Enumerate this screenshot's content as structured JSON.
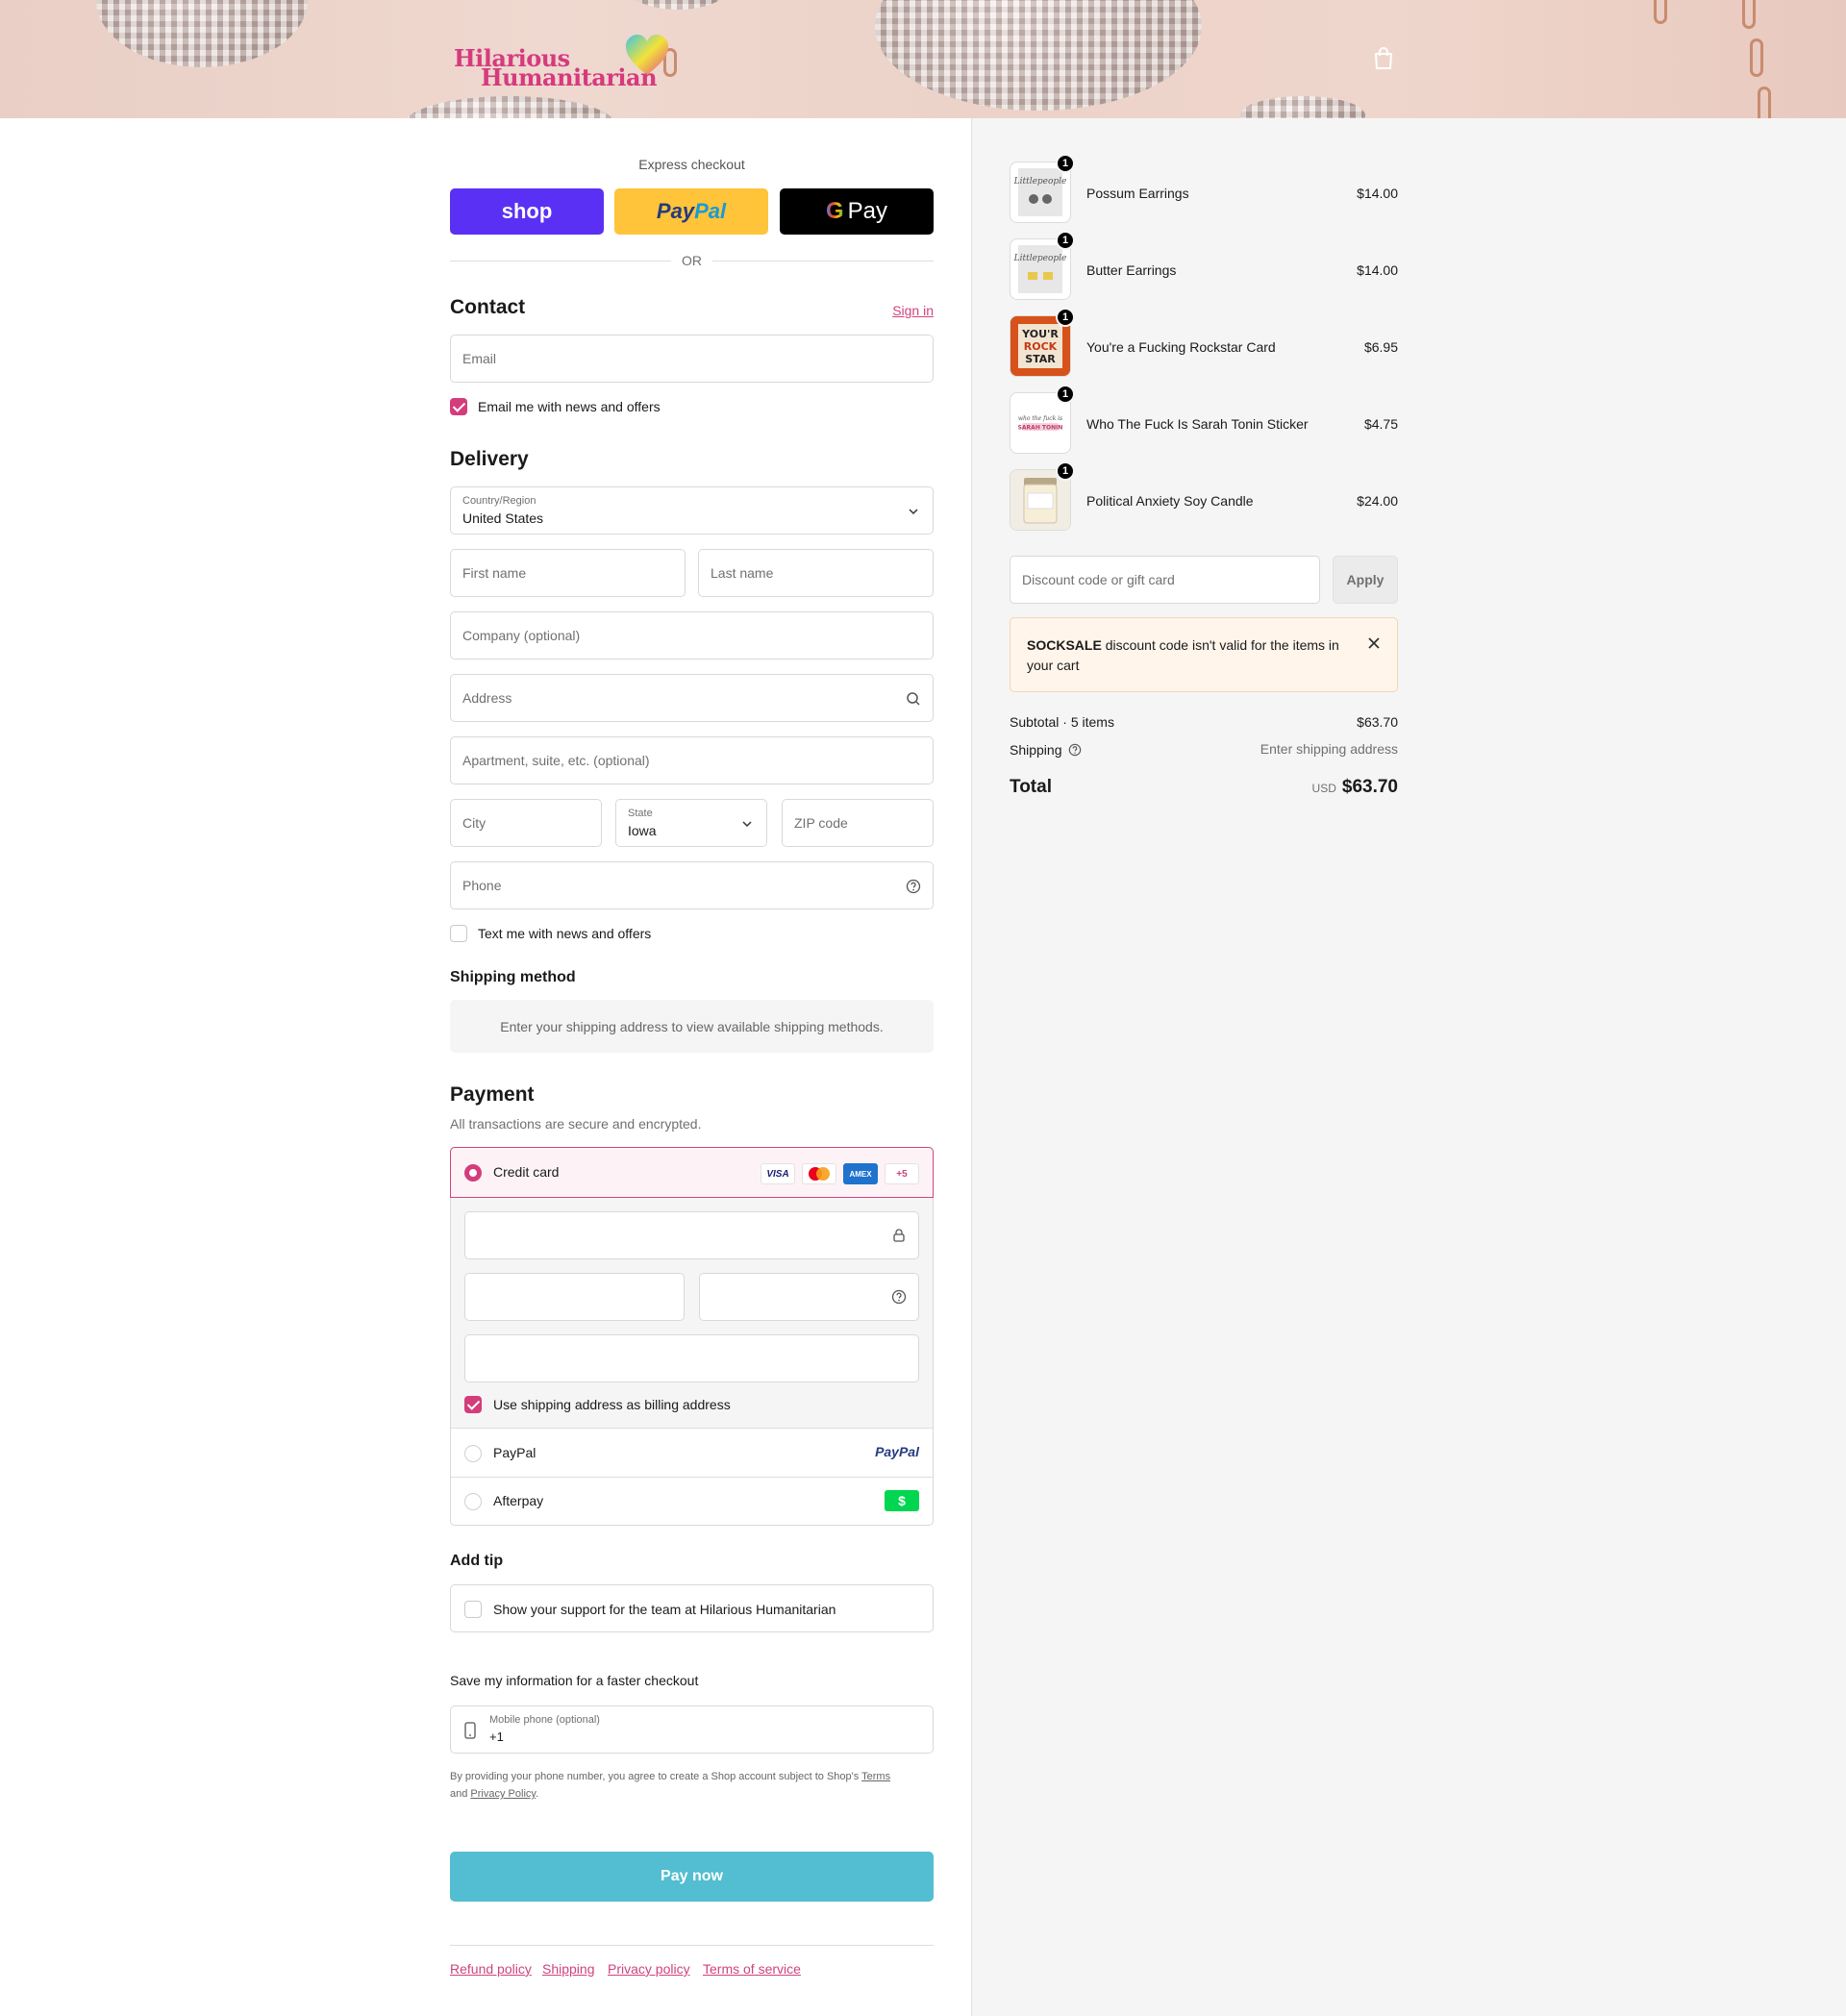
{
  "header": {
    "logo_line1": "Hilarious",
    "logo_line2": "Humanitarian"
  },
  "express": {
    "title": "Express checkout",
    "shop_label": "shop",
    "paypal_label": "PayPal",
    "gpay_label": "G Pay",
    "or_label": "OR"
  },
  "contact": {
    "heading": "Contact",
    "sign_in": "Sign in",
    "email_placeholder": "Email",
    "news_label": "Email me with news and offers",
    "news_checked": true
  },
  "delivery": {
    "heading": "Delivery",
    "country_label": "Country/Region",
    "country_value": "United States",
    "first_name": "First name",
    "last_name": "Last name",
    "company": "Company (optional)",
    "address": "Address",
    "apartment": "Apartment, suite, etc. (optional)",
    "city": "City",
    "state_label": "State",
    "state_value": "Iowa",
    "zip": "ZIP code",
    "phone": "Phone",
    "text_news_label": "Text me with news and offers"
  },
  "shipping_method": {
    "heading": "Shipping method",
    "message": "Enter your shipping address to view available shipping methods."
  },
  "payment": {
    "heading": "Payment",
    "subtitle": "All transactions are secure and encrypted.",
    "credit_card_label": "Credit card",
    "brands": [
      "VISA",
      "MC",
      "AMEX",
      "+5"
    ],
    "billing_label": "Use shipping address as billing address",
    "paypal_label": "PayPal",
    "paypal_logo": "PayPal",
    "afterpay_label": "Afterpay",
    "afterpay_logo": "$"
  },
  "tip": {
    "heading": "Add tip",
    "label": "Show your support for the team at Hilarious Humanitarian"
  },
  "save_info": {
    "heading": "Save my information for a faster checkout",
    "mobile_label": "Mobile phone (optional)",
    "mobile_value": "+1",
    "disclaimer_pre": "By providing your phone number, you agree to create a Shop account subject to Shop's",
    "terms": "Terms",
    "and": "and",
    "privacy": "Privacy Policy",
    "period": "."
  },
  "pay_now": "Pay now",
  "footer": {
    "links": [
      "Refund policy",
      "Shipping",
      "Privacy policy",
      "Terms of service"
    ]
  },
  "cart": {
    "items": [
      {
        "name": "Possum Earrings",
        "price": "$14.00",
        "qty": "1"
      },
      {
        "name": "Butter Earrings",
        "price": "$14.00",
        "qty": "1"
      },
      {
        "name": "You're a Fucking Rockstar Card",
        "price": "$6.95",
        "qty": "1"
      },
      {
        "name": "Who The Fuck Is Sarah Tonin Sticker",
        "price": "$4.75",
        "qty": "1"
      },
      {
        "name": "Political Anxiety Soy Candle",
        "price": "$24.00",
        "qty": "1"
      }
    ],
    "discount_placeholder": "Discount code or gift card",
    "apply_label": "Apply",
    "alert_code": "SOCKSALE",
    "alert_text": "discount code isn't valid for the items in your cart",
    "subtotal_label": "Subtotal · 5 items",
    "subtotal_value": "$63.70",
    "shipping_label": "Shipping",
    "shipping_value": "Enter shipping address",
    "total_label": "Total",
    "currency": "USD",
    "total_value": "$63.70"
  },
  "colors": {
    "accent": "#d43c7b",
    "pay_button": "#53bdd1",
    "shop": "#5a31f4",
    "paypal": "#ffc439"
  }
}
